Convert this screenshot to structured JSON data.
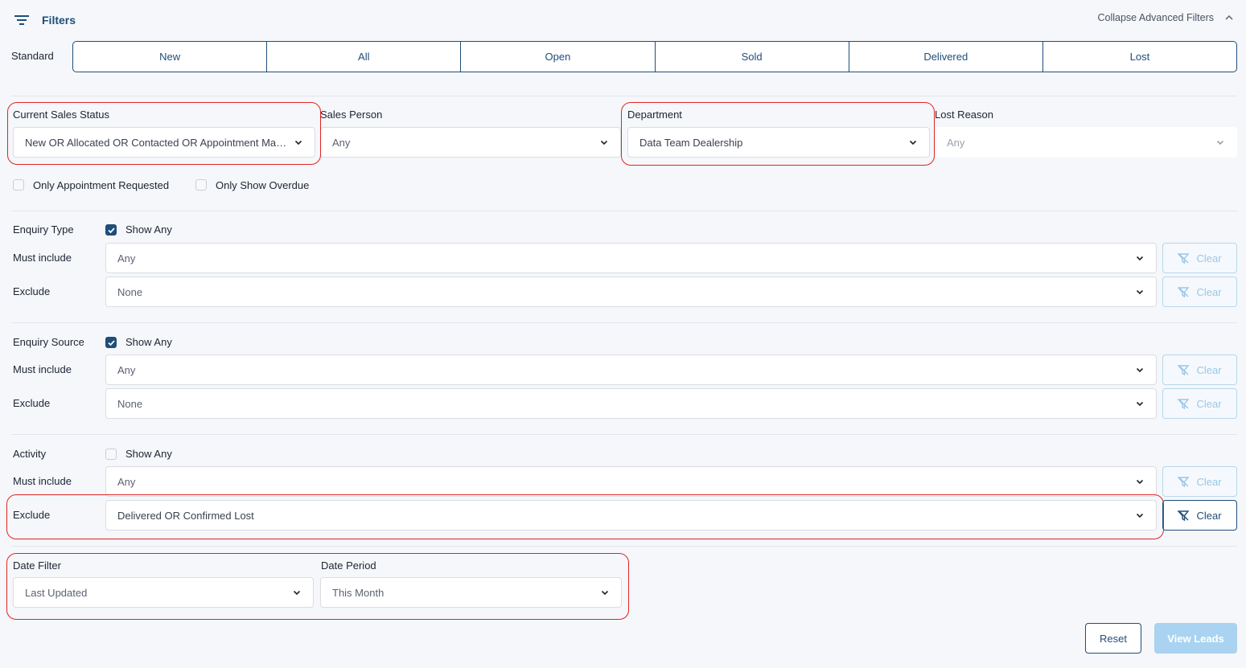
{
  "header": {
    "title": "Filters",
    "collapse_label": "Collapse Advanced Filters",
    "filter_icon": "filter-lines-icon",
    "collapse_icon": "chevron-up-icon"
  },
  "standard": {
    "label": "Standard",
    "tabs": [
      "New",
      "All",
      "Open",
      "Sold",
      "Delivered",
      "Lost"
    ]
  },
  "status_row": {
    "current_sales_status": {
      "label": "Current Sales Status",
      "value": "New OR Allocated OR Contacted OR Appointment Made ..."
    },
    "sales_person": {
      "label": "Sales Person",
      "value": "Any"
    },
    "department": {
      "label": "Department",
      "value": "Data Team Dealership"
    },
    "lost_reason": {
      "label": "Lost Reason",
      "value": "Any"
    }
  },
  "checkboxes": {
    "only_appointment": "Only Appointment Requested",
    "only_overdue": "Only Show Overdue"
  },
  "enquiry_type": {
    "label": "Enquiry Type",
    "show_any": "Show Any",
    "must_include_label": "Must include",
    "must_include_value": "Any",
    "exclude_label": "Exclude",
    "exclude_value": "None"
  },
  "enquiry_source": {
    "label": "Enquiry Source",
    "show_any": "Show Any",
    "must_include_label": "Must include",
    "must_include_value": "Any",
    "exclude_label": "Exclude",
    "exclude_value": "None"
  },
  "activity": {
    "label": "Activity",
    "show_any": "Show Any",
    "must_include_label": "Must include",
    "must_include_value": "Any",
    "exclude_label": "Exclude",
    "exclude_value": "Delivered OR Confirmed Lost"
  },
  "clear_label": "Clear",
  "date": {
    "filter_label": "Date Filter",
    "filter_value": "Last Updated",
    "period_label": "Date Period",
    "period_value": "This Month"
  },
  "actions": {
    "reset": "Reset",
    "view": "View Leads"
  },
  "colors": {
    "primary": "#1f4e79",
    "highlight": "#e02424",
    "disabled": "#a9d3f0"
  }
}
